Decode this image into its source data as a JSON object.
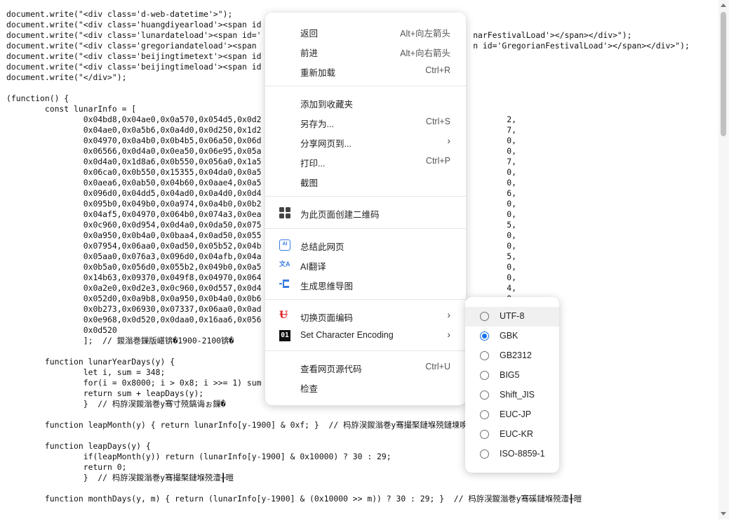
{
  "source_code": {
    "block_a": "document.write(\"<div class='d-web-datetime'>\");\ndocument.write(\"<div class='huangdiyearload'><span id\ndocument.write(\"<div class='lunardateload'><span id='                                            narFestivalLoad'></span></div>\");\ndocument.write(\"<div class='gregoriandateload'><span                                             n id='GregorianFestivalLoad'></span></div>\");\ndocument.write(\"<div class='beijingtimetext'><span id\ndocument.write(\"<div class='beijingtimeload'><span id\ndocument.write(\"</div>\");",
    "block_b": "(function() {\n        const lunarInfo = [\n                0x04bd8,0x04ae0,0x0a570,0x054d5,0x0d2                                                   2,\n                0x04ae0,0x0a5b6,0x0a4d0,0x0d250,0x1d2                                                   7,\n                0x04970,0x0a4b0,0x0b4b5,0x06a50,0x06d                                                   0,\n                0x06566,0x0d4a0,0x0ea50,0x06e95,0x05a                                                   0,\n                0x0d4a0,0x1d8a6,0x0b550,0x056a0,0x1a5                                                   7,\n                0x06ca0,0x0b550,0x15355,0x04da0,0x0a5                                                   0,\n                0x0aea6,0x0ab50,0x04b60,0x0aae4,0x0a5                                                   0,\n                0x096d0,0x04dd5,0x04ad0,0x0a4d0,0x0d4                                                   6,\n                0x095b0,0x049b0,0x0a974,0x0a4b0,0x0b2                                                   0,\n                0x04af5,0x04970,0x064b0,0x074a3,0x0ea                                                   0,\n                0x0c960,0x0d954,0x0d4a0,0x0da50,0x075                                                   5,\n                0x0a950,0x0b4a0,0x0baa4,0x0ad50,0x055                                                   0,\n                0x07954,0x06aa0,0x0ad50,0x05b52,0x04b                                                   0,\n                0x05aa0,0x076a3,0x096d0,0x04afb,0x04a                                                   5,\n                0x0b5a0,0x056d0,0x055b2,0x049b0,0x0a5                                                   0,\n                0x14b63,0x09370,0x049f8,0x04970,0x064                                                   0,\n                0x0a2e0,0x0d2e3,0x0c960,0x0d557,0x0d4                                                   4,\n                0x052d0,0x0a9b8,0x0a950,0x0b4a0,0x0b6                                                   0,\n                0x0b273,0x06930,0x07337,0x06aa0,0x0ad                                                   0,\n                0x0e968,0x0d520,0x0daa0,0x16aa6,0x056                                                   0,\n                0x0d520\n                ];  // 鍐滃巻鏁版嵁锛�1900-2100锛�\n\n        function lunarYearDays(y) {\n                let i, sum = 348;\n                for(i = 0x8000; i > 0x8; i >>= 1) sum\n                return sum + leapDays(y);\n                }  // 杩斿洖鍐滃巻y骞寸殑鎬诲ぉ鏁�\n\n        function leapMonth(y) { return lunarInfo[y-1900] & 0xf; }  // 杩斿洖鍐滃巻y骞撮棸鏈堢殑鏈堜唤锛屾病鏈夐棸鏈堣繑鍥�0\n\n        function leapDays(y) {\n                if(leapMonth(y)) return (lunarInfo[y-1900] & 0x10000) ? 30 : 29;\n                return 0;\n                }  // 杩斿洖鍐滃巻y骞撮棸鏈堢殑澶╂暟\n\n        function monthDays(y, m) { return (lunarInfo[y-1900] & (0x10000 >> m)) ? 30 : 29; }  // 杩斿洖鍐滃巻y骞磎鏈堢殑澶╂暟"
  },
  "context_menu": {
    "back": {
      "label": "返回",
      "shortcut": "Alt+向左箭头"
    },
    "forward": {
      "label": "前进",
      "shortcut": "Alt+向右箭头"
    },
    "reload": {
      "label": "重新加载",
      "shortcut": "Ctrl+R"
    },
    "bookmark": {
      "label": "添加到收藏夹"
    },
    "save_as": {
      "label": "另存为...",
      "shortcut": "Ctrl+S"
    },
    "share": {
      "label": "分享网页到..."
    },
    "print": {
      "label": "打印...",
      "shortcut": "Ctrl+P"
    },
    "screenshot": {
      "label": "截图"
    },
    "qr_code": {
      "label": "为此页面创建二维码"
    },
    "summarize": {
      "label": "总结此网页"
    },
    "ai_translate": {
      "label": "AI翻译"
    },
    "mind_map": {
      "label": "生成思维导图"
    },
    "switch_encoding": {
      "label": "切换页面编码"
    },
    "set_char_encoding": {
      "label": "Set Character Encoding"
    },
    "view_source": {
      "label": "查看网页源代码",
      "shortcut": "Ctrl+U"
    },
    "inspect": {
      "label": "检查"
    }
  },
  "encoding_submenu": {
    "options": [
      "UTF-8",
      "GBK",
      "GB2312",
      "BIG5",
      "Shift_JIS",
      "EUC-JP",
      "EUC-KR",
      "ISO-8859-1"
    ],
    "selected": "GBK",
    "hovered": "UTF-8"
  },
  "colors": {
    "highlight_border": "#e03a3a",
    "radio_selected": "#1a73e8",
    "ai_icon": "#3a7be0"
  }
}
